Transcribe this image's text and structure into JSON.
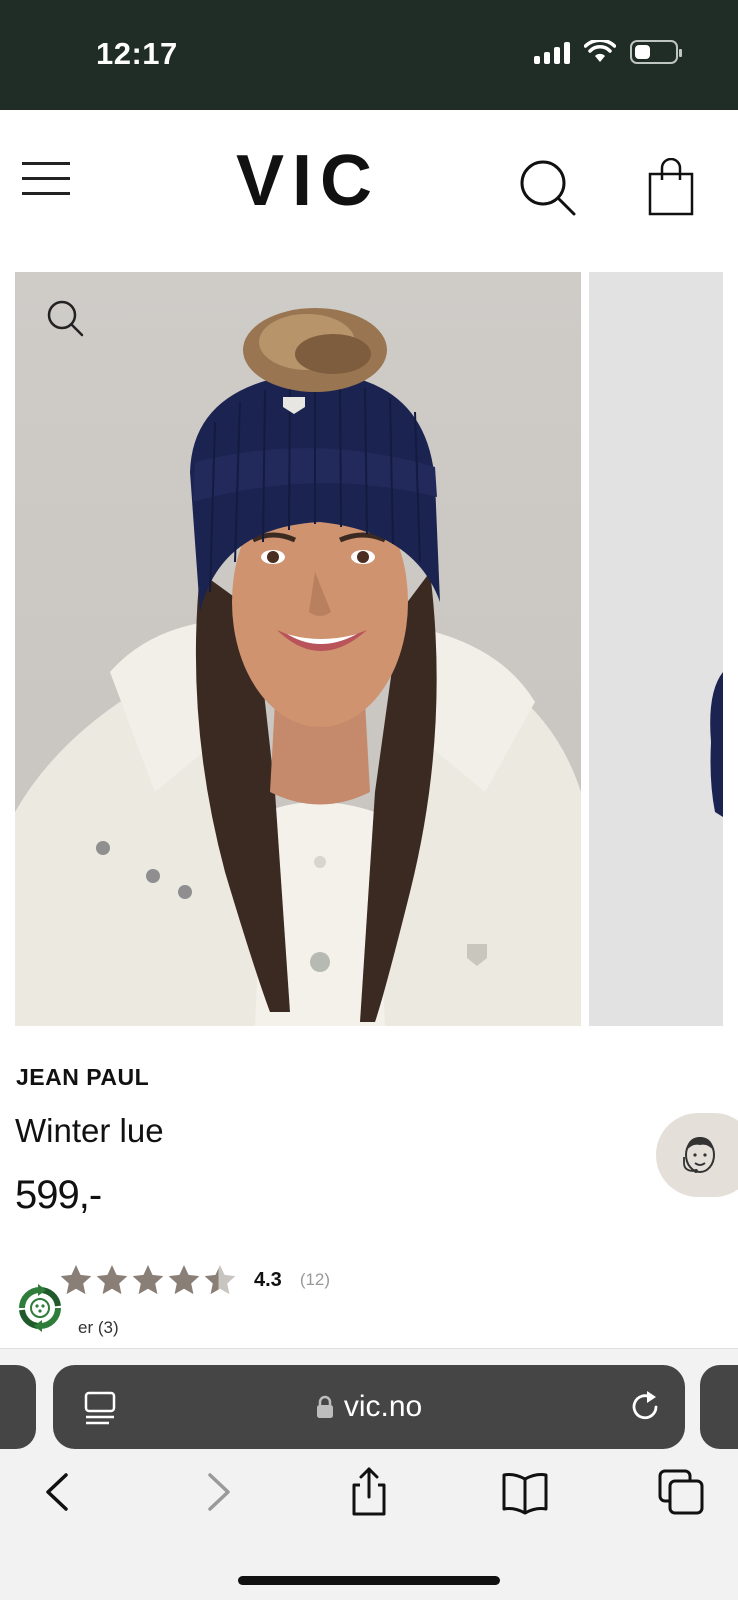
{
  "status_bar": {
    "time": "12:17",
    "signal_bars": 4,
    "battery_level": 0.4
  },
  "header": {
    "logo": "VIC",
    "icons": [
      "menu-icon",
      "search-icon",
      "shopping-bag-icon"
    ]
  },
  "gallery": {
    "images": [
      "woman-wearing-navy-knit-beanie-with-fur-pompom",
      "next-product-image-partial"
    ]
  },
  "product": {
    "brand": "JEAN PAUL",
    "name": "Winter lue",
    "price": "599,-",
    "rating": {
      "stars": 4.3,
      "value": "4.3",
      "count": "(12)"
    },
    "questions": "er (3)"
  },
  "browser": {
    "url": "vic.no",
    "colors": {
      "status_bar_bg": "#1f2d26",
      "address_bar_bg": "#454545",
      "star_color": "#8a7f76",
      "chat_bg": "#e4dfd9"
    }
  }
}
